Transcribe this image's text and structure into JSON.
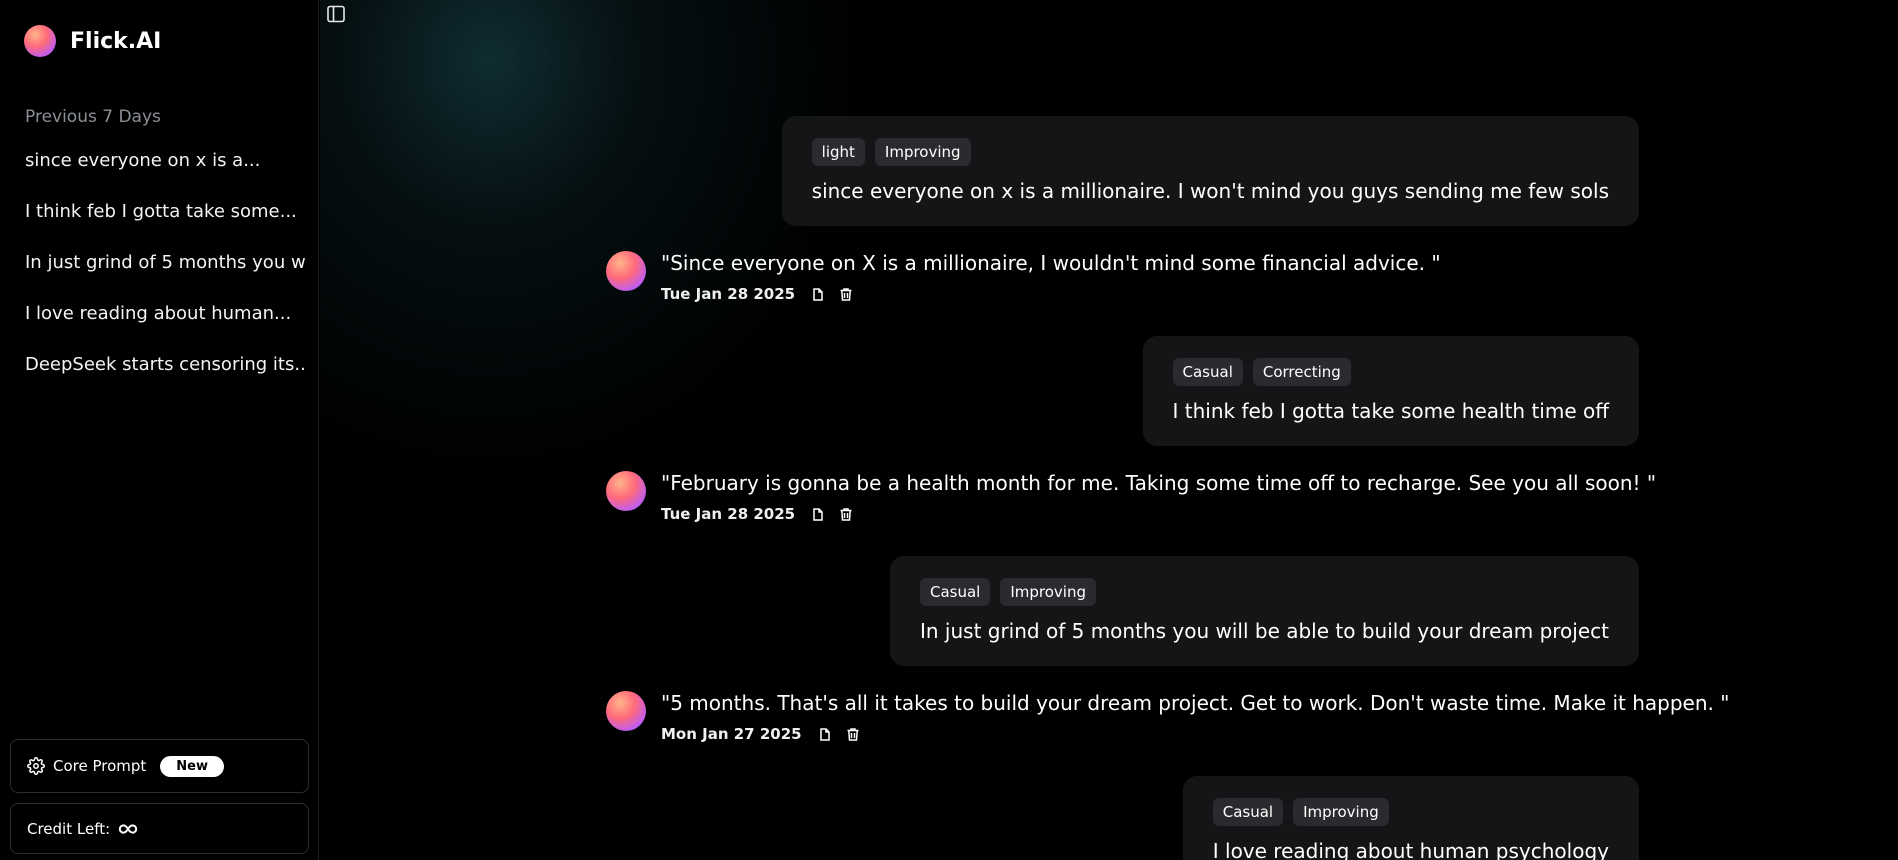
{
  "app": {
    "name": "Flick.AI"
  },
  "sidebar": {
    "section_title": "Previous 7 Days",
    "history": [
      "since everyone on x is a...",
      "I think feb I gotta take some...",
      "In just grind of 5 months you w...",
      "I love reading about human...",
      "DeepSeek starts censoring its..."
    ],
    "core_prompt_label": "Core Prompt",
    "new_badge": "New",
    "credit_label": "Credit Left:",
    "credit_icon": "infinity-icon"
  },
  "conversation": [
    {
      "user": {
        "tags": [
          "light",
          "Improving"
        ],
        "text": "since everyone on x is a millionaire. I won't mind you guys sending me few sols"
      },
      "ai": {
        "text": "\"Since everyone on X is a millionaire, I wouldn't mind some financial advice. \"",
        "date": "Tue Jan 28 2025"
      }
    },
    {
      "user": {
        "tags": [
          "Casual",
          "Correcting"
        ],
        "text": "I think feb I gotta take some health time off"
      },
      "ai": {
        "text": "\"February is gonna be a health month for me. Taking some time off to recharge. See you all soon! \"",
        "date": "Tue Jan 28 2025"
      }
    },
    {
      "user": {
        "tags": [
          "Casual",
          "Improving"
        ],
        "text": "In just grind of 5 months you will be able to build your dream project"
      },
      "ai": {
        "text": "\"5 months. That's all it takes to build your dream project. Get to work. Don't waste time. Make it happen. \"",
        "date": "Mon Jan 27 2025"
      }
    },
    {
      "user": {
        "tags": [
          "Casual",
          "Improving"
        ],
        "text": "I love reading about human psychology"
      }
    }
  ],
  "icons": {
    "sidebar_toggle": "sidebar-toggle-icon",
    "copy": "copy-icon",
    "delete": "trash-icon",
    "settings": "gear-icon"
  },
  "colors": {
    "background": "#000000",
    "bubble": "#141517",
    "tag": "#2a2b2e",
    "muted_text": "#8a8f96"
  }
}
